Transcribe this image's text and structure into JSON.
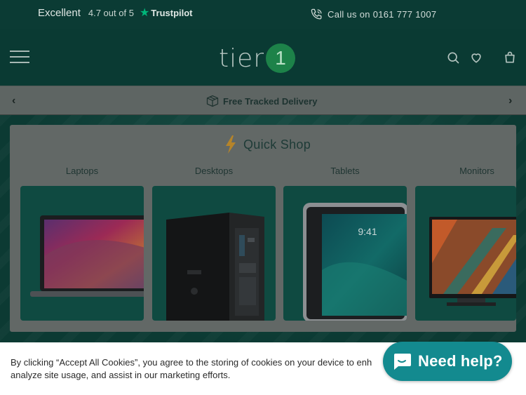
{
  "topbar": {
    "excellent": "Excellent",
    "score": "4.7 out of 5",
    "trustpilot": "Trustpilot",
    "call": "Call us on 0161 777 1007"
  },
  "header": {
    "logo_word": "tier",
    "logo_number": "1"
  },
  "delivery": {
    "text": "Free Tracked Delivery"
  },
  "quick_shop": {
    "title": "Quick Shop",
    "categories": [
      {
        "label": "Laptops",
        "icon": "laptop-image"
      },
      {
        "label": "Desktops",
        "icon": "desktop-tower-image"
      },
      {
        "label": "Tablets",
        "icon": "tablet-image"
      },
      {
        "label": "Monitors",
        "icon": "monitor-image"
      }
    ],
    "tablet_time": "9:41"
  },
  "cookie": {
    "text": "By clicking “Accept All Cookies”, you agree to the storing of cookies on your device to enh",
    "text2": "analyze site usage, and assist in our marketing efforts."
  },
  "chat": {
    "label": "Need help?"
  },
  "colors": {
    "brand_dark": "#0b3b34",
    "brand_green": "#1d8249",
    "trustpilot_star": "#00b67a",
    "chat_bg": "#138a8f",
    "bolt": "#e0a12a"
  }
}
